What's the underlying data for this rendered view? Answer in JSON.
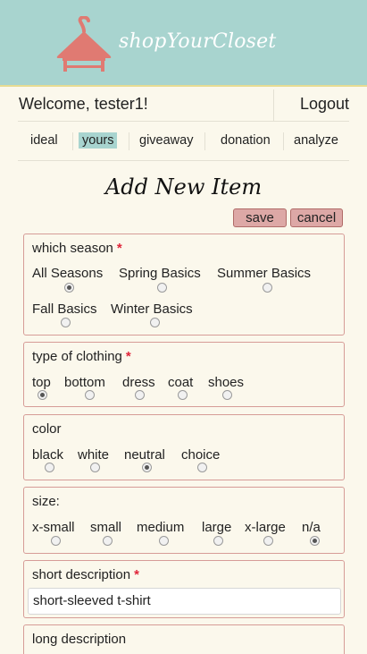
{
  "brand": {
    "name": "shopYourCloset",
    "logo_icon": "hanger-icon",
    "colors": {
      "header": "#a8d4cf",
      "logo": "#e07a72",
      "required": "#e0253a"
    }
  },
  "account": {
    "welcome": "Welcome, tester1!",
    "logout": "Logout"
  },
  "nav": {
    "tabs": [
      {
        "label": "ideal"
      },
      {
        "label": "yours",
        "active": true
      },
      {
        "label": "giveaway"
      },
      {
        "label": "donation"
      },
      {
        "label": "analyze"
      }
    ]
  },
  "page": {
    "title": "Add New Item"
  },
  "actions": {
    "save": "save",
    "cancel": "cancel"
  },
  "form": {
    "season": {
      "label": "which season",
      "required": "*",
      "options": [
        "All Seasons",
        "Spring Basics",
        "Summer Basics",
        "Fall Basics",
        "Winter Basics"
      ],
      "selected": "All Seasons"
    },
    "clothing_type": {
      "label": "type of clothing",
      "required": "*",
      "options": [
        "top",
        "bottom",
        "dress",
        "coat",
        "shoes"
      ],
      "selected": "top"
    },
    "color": {
      "label": "color",
      "options": [
        "black",
        "white",
        "neutral",
        "choice"
      ],
      "selected": "neutral"
    },
    "size": {
      "label": "size:",
      "options": [
        "x-small",
        "small",
        "medium",
        "large",
        "x-large",
        "n/a"
      ],
      "selected": "n/a"
    },
    "short_description": {
      "label": "short description",
      "required": "*",
      "value": "short-sleeved t-shirt"
    },
    "long_description": {
      "label": "long description"
    }
  }
}
